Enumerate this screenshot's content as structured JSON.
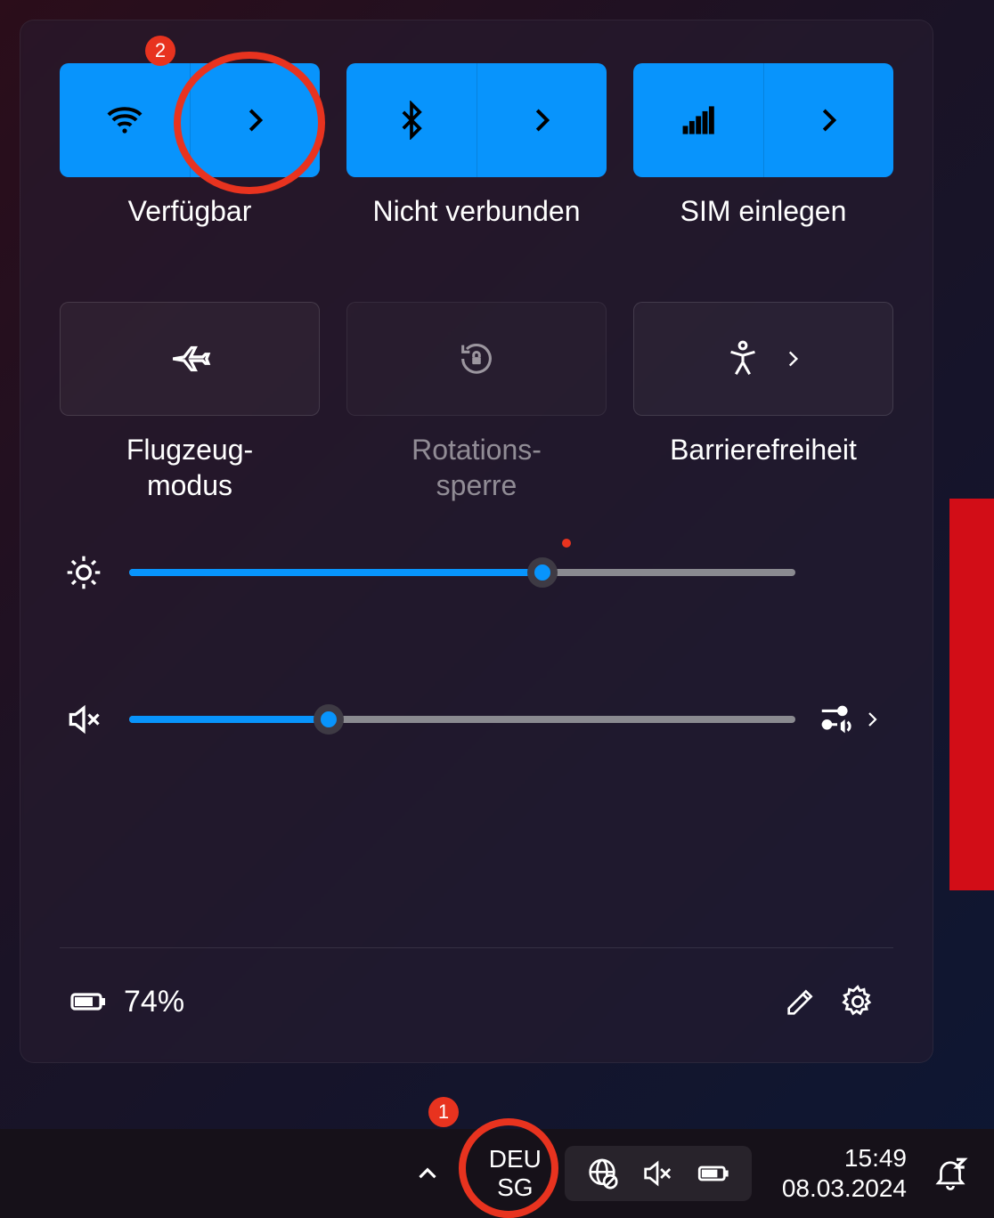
{
  "quick_settings": {
    "tiles": [
      {
        "id": "wifi",
        "label": "Verfügbar",
        "active": true,
        "split": true,
        "icon": "wifi-icon",
        "disabled": false
      },
      {
        "id": "bluetooth",
        "label": "Nicht verbunden",
        "active": true,
        "split": true,
        "icon": "bluetooth-icon",
        "disabled": false
      },
      {
        "id": "cellular",
        "label": "SIM einlegen",
        "active": true,
        "split": true,
        "icon": "signal-bars-icon",
        "disabled": false
      },
      {
        "id": "airplane",
        "label": "Flugzeug-\nmodus",
        "active": false,
        "split": false,
        "icon": "airplane-icon",
        "disabled": false
      },
      {
        "id": "rotation-lock",
        "label": "Rotations-\nsperre",
        "active": false,
        "split": false,
        "icon": "rotation-lock-icon",
        "disabled": true
      },
      {
        "id": "accessibility",
        "label": "Barrierefreiheit",
        "active": false,
        "split": true,
        "icon": "accessibility-icon",
        "disabled": false
      }
    ],
    "brightness_percent": 62,
    "volume_percent": 30,
    "volume_muted": true,
    "battery_percent_label": "74%"
  },
  "taskbar": {
    "language_primary": "DEU",
    "language_secondary": "SG",
    "time": "15:49",
    "date": "08.03.2024"
  },
  "annotations": {
    "badge1": "1",
    "badge2": "2"
  },
  "accent_color": "#0894fc"
}
